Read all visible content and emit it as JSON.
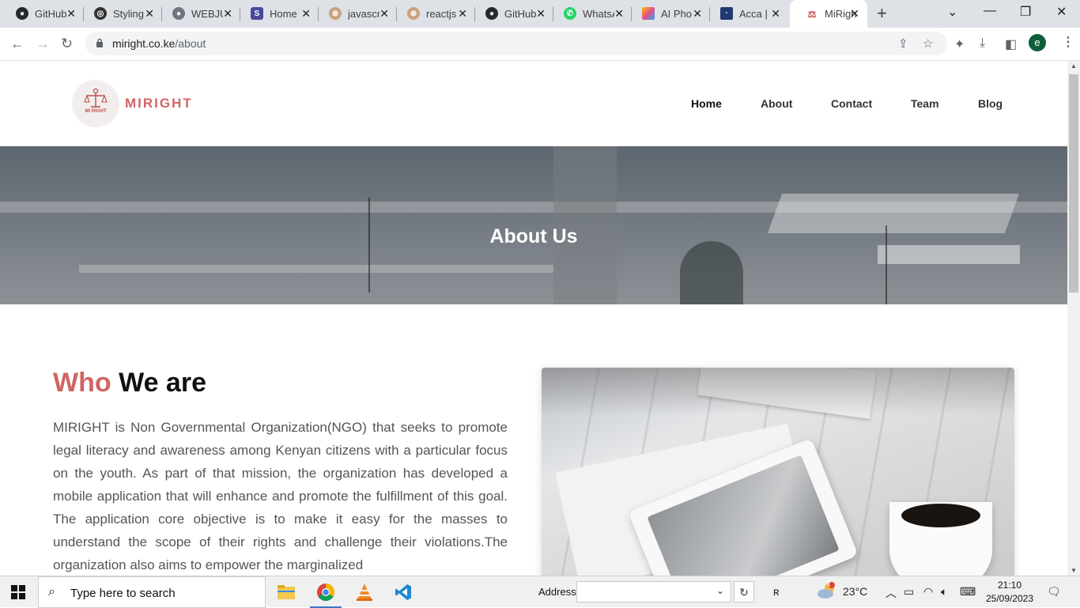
{
  "browser": {
    "tabs": [
      {
        "title": "GitHub",
        "icon": "github-icon",
        "color": "#24292f"
      },
      {
        "title": "Styling",
        "icon": "styling-icon",
        "color": "#333333"
      },
      {
        "title": "WEBJU",
        "icon": "github-icon",
        "color": "#6e7681"
      },
      {
        "title": "Home",
        "icon": "s-icon",
        "color": "#4a4a9c"
      },
      {
        "title": "javascr",
        "icon": "stack-icon",
        "color": "#c9a27e"
      },
      {
        "title": "reactjs",
        "icon": "stack-icon",
        "color": "#c9a27e"
      },
      {
        "title": "GitHub",
        "icon": "github-icon",
        "color": "#24292f"
      },
      {
        "title": "WhatsA",
        "icon": "whatsapp-icon",
        "color": "#25d366"
      },
      {
        "title": "AI Pho",
        "icon": "ai-photo-icon",
        "color": "#e94d8a"
      },
      {
        "title": "Acca |",
        "icon": "acca-icon",
        "color": "#1e3a6e"
      },
      {
        "title": "MiRigh",
        "icon": "miright-icon",
        "color": "#c0504d",
        "active": true
      }
    ],
    "url_host": "miright.co.ke",
    "url_path": "/about",
    "profile_initial": "e"
  },
  "site": {
    "brand": "MIRIGHT",
    "logo_text": "MI RIGHT",
    "nav": [
      "Home",
      "About",
      "Contact",
      "Team",
      "Blog"
    ],
    "hero_title": "About Us",
    "heading_accent": "Who",
    "heading_rest": "We are",
    "paragraph": "MIRIGHT is Non Governmental Organization(NGO) that seeks to promote legal literacy and awareness among Kenyan citizens with a particular focus on the youth. As part of that mission, the organization has developed a mobile application that will enhance and promote the fulfillment of this goal. The application core objective is to make it easy for the masses to understand the scope of their rights and challenge their violations.The organization also aims to empower the marginalized",
    "accent_color": "#d16464"
  },
  "taskbar": {
    "search_placeholder": "Type here to search",
    "address_label": "Address",
    "weather": "23°C",
    "weather_badge": "1",
    "time": "21:10",
    "date": "25/09/2023"
  }
}
